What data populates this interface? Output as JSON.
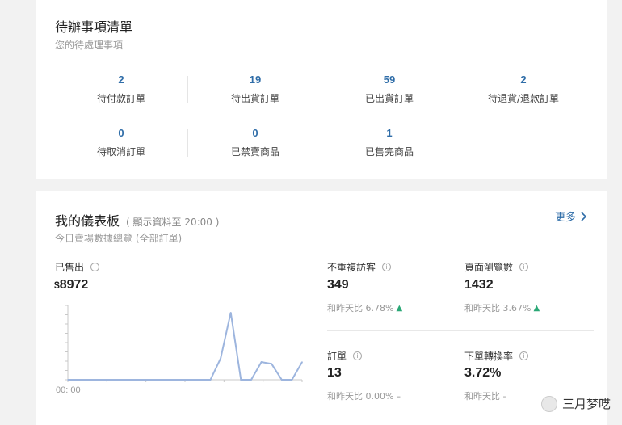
{
  "todo": {
    "title": "待辦事項清單",
    "subtitle": "您的待處理事項",
    "items": [
      {
        "count": "2",
        "label": "待付款訂單"
      },
      {
        "count": "19",
        "label": "待出貨訂單"
      },
      {
        "count": "59",
        "label": "已出貨訂單"
      },
      {
        "count": "2",
        "label": "待退貨/退款訂單"
      },
      {
        "count": "0",
        "label": "待取消訂單"
      },
      {
        "count": "0",
        "label": "已禁賣商品"
      },
      {
        "count": "1",
        "label": "已售完商品"
      }
    ]
  },
  "dashboard": {
    "title": "我的儀表板",
    "note": "( 顯示資料至 20:00 )",
    "subtitle": "今日賣場數據總覽 (全部訂單)",
    "more_label": "更多",
    "sold_label": "已售出",
    "sold_currency": "$",
    "sold_value": "8972",
    "chart_xlabel": "00: 00",
    "metrics": [
      {
        "label": "不重複訪客",
        "value": "349",
        "compare": "和昨天比 6.78%",
        "trend": "up"
      },
      {
        "label": "頁面瀏覽數",
        "value": "1432",
        "compare": "和昨天比 3.67%",
        "trend": "up"
      },
      {
        "label": "訂單",
        "value": "13",
        "compare": "和昨天比 0.00%",
        "trend": "flat"
      },
      {
        "label": "下單轉換率",
        "value": "3.72%",
        "compare": "和昨天比 -",
        "trend": "down"
      }
    ]
  },
  "watermark": {
    "text": "三月梦呓"
  },
  "colors": {
    "accent": "#2f6da8",
    "up": "#2aa876",
    "chart_line": "#9db5de"
  },
  "chart_data": {
    "type": "line",
    "x": [
      0,
      1,
      2,
      3,
      4,
      5,
      6,
      7,
      8,
      9,
      10,
      11,
      12,
      13,
      14,
      15,
      16,
      17,
      18,
      19,
      20,
      21,
      22,
      23
    ],
    "values": [
      0,
      0,
      0,
      0,
      0,
      0,
      0,
      0,
      0,
      0,
      0,
      0,
      0,
      0,
      0,
      1200,
      3800,
      0,
      0,
      1000,
      900,
      0,
      0,
      1000
    ],
    "ylim": [
      0,
      4200
    ],
    "xlabel": "00: 00",
    "grid": false
  }
}
